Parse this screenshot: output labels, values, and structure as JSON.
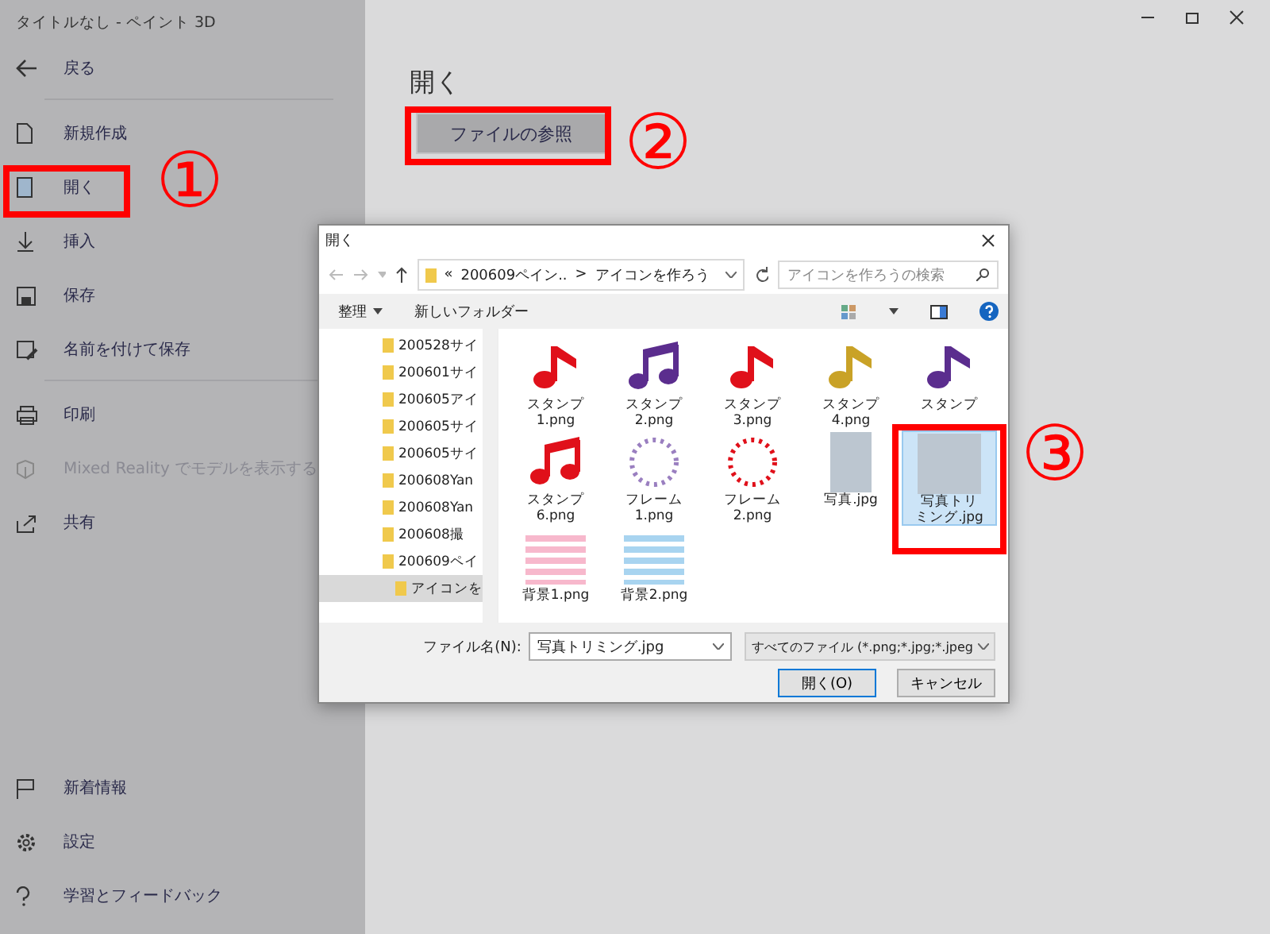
{
  "window": {
    "title": "タイトルなし - ペイント 3D"
  },
  "sidebar": {
    "top": [
      {
        "kind": "back",
        "label": "戻る",
        "disabled": false
      }
    ],
    "groups": [
      [
        {
          "kind": "new",
          "label": "新規作成",
          "disabled": false
        },
        {
          "kind": "open",
          "label": "開く",
          "disabled": false
        },
        {
          "kind": "insert",
          "label": "挿入",
          "disabled": false
        },
        {
          "kind": "save",
          "label": "保存",
          "disabled": false
        },
        {
          "kind": "saveas",
          "label": "名前を付けて保存",
          "disabled": false
        }
      ],
      [
        {
          "kind": "print",
          "label": "印刷",
          "disabled": false
        },
        {
          "kind": "mixed",
          "label": "Mixed Reality でモデルを表示する",
          "disabled": true
        },
        {
          "kind": "share",
          "label": "共有",
          "disabled": false
        }
      ]
    ],
    "bottom": [
      {
        "kind": "news",
        "label": "新着情報",
        "disabled": false
      },
      {
        "kind": "settings",
        "label": "設定",
        "disabled": false
      },
      {
        "kind": "feedback",
        "label": "学習とフィードバック",
        "disabled": false
      }
    ]
  },
  "main": {
    "heading": "開く",
    "browse_button": "ファイルの参照"
  },
  "dialog": {
    "title": "開く",
    "address": {
      "overflow": "«",
      "crumbs": [
        "200609ペイン..",
        "アイコンを作ろう"
      ],
      "separator": ">"
    },
    "search": {
      "placeholder": "アイコンを作ろうの検索"
    },
    "toolbar": {
      "organize": "整理",
      "new_folder": "新しいフォルダー"
    },
    "tree": [
      {
        "label": "200528サイ",
        "selected": false
      },
      {
        "label": "200601サイ",
        "selected": false
      },
      {
        "label": "200605アイ",
        "selected": false
      },
      {
        "label": "200605サイ",
        "selected": false
      },
      {
        "label": "200605サイ",
        "selected": false
      },
      {
        "label": "200608Yan",
        "selected": false
      },
      {
        "label": "200608Yan",
        "selected": false
      },
      {
        "label": "200608撮",
        "selected": false
      },
      {
        "label": "200609ペイ",
        "selected": false
      },
      {
        "label": "アイコンを",
        "selected": true
      }
    ],
    "files": [
      {
        "name": "スタンプ1.png",
        "kind": "note",
        "color": "#e0101a",
        "selected": false
      },
      {
        "name": "スタンプ2.png",
        "kind": "beamed",
        "color": "#5b2d8e",
        "selected": false
      },
      {
        "name": "スタンプ3.png",
        "kind": "note",
        "color": "#e0101a",
        "selected": false
      },
      {
        "name": "スタンプ4.png",
        "kind": "note",
        "color": "#c9a227",
        "selected": false
      },
      {
        "name": "スタンプ",
        "kind": "note",
        "color": "#5b2d8e",
        "selected": false
      },
      {
        "name": "スタンプ6.png",
        "kind": "beamed",
        "color": "#e0101a",
        "selected": false
      },
      {
        "name": "フレーム1.png",
        "kind": "frame",
        "color": "#9a7fc0",
        "selected": false
      },
      {
        "name": "フレーム2.png",
        "kind": "frame",
        "color": "#e0101a",
        "selected": false
      },
      {
        "name": "写真.jpg",
        "kind": "photo",
        "color": "#bcc6d0",
        "selected": false
      },
      {
        "name": "写真トリミング.jpg",
        "kind": "photo",
        "color": "#bcc6d0",
        "selected": true
      },
      {
        "name": "背景1.png",
        "kind": "stripes",
        "color": "#f7b8cc",
        "selected": false
      },
      {
        "name": "背景2.png",
        "kind": "stripes",
        "color": "#a8d4f0",
        "selected": false
      }
    ],
    "filename_label": "ファイル名(N):",
    "filename": "写真トリミング.jpg",
    "filter": "すべてのファイル (*.png;*.jpg;*.jpeg",
    "buttons": [
      {
        "label": "開く(O)",
        "primary": true
      },
      {
        "label": "キャンセル",
        "primary": false
      }
    ]
  },
  "annotations": [
    {
      "number": "①"
    },
    {
      "number": "②"
    },
    {
      "number": "③"
    }
  ]
}
